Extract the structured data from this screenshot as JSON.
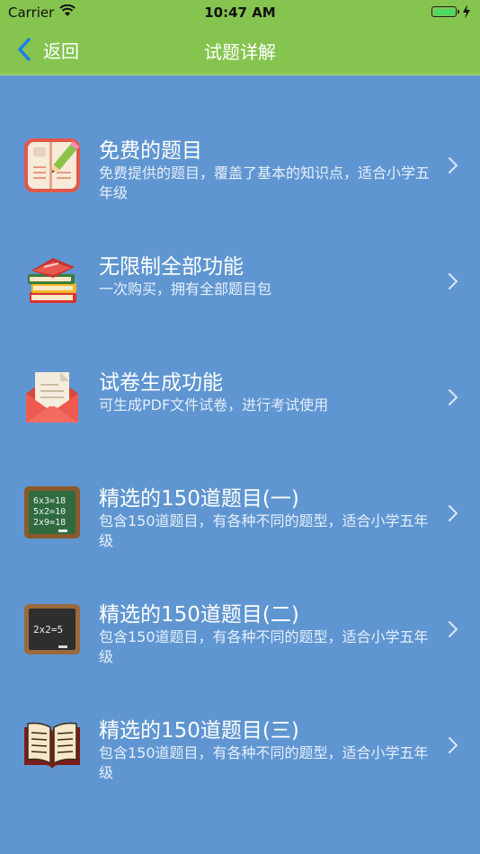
{
  "status_bar": {
    "carrier": "Carrier",
    "time": "10:47 AM"
  },
  "nav": {
    "back_label": "返回",
    "title": "试题详解"
  },
  "items": [
    {
      "title": "免费的题目",
      "desc": "免费提供的题目，覆盖了基本的知识点，适合小学五年级",
      "icon": "notebook-pencil-icon"
    },
    {
      "title": "无限制全部功能",
      "desc": "一次购买，拥有全部题目包",
      "icon": "book-stack-icon"
    },
    {
      "title": "试卷生成功能",
      "desc": "可生成PDF文件试卷，进行考试使用",
      "icon": "envelope-letter-icon"
    },
    {
      "title": "精选的150道题目(一)",
      "desc": "包含150道题目，有各种不同的题型，适合小学五年级",
      "icon": "green-chalkboard-icon",
      "board_lines": [
        "6x3=18",
        "5x2=10",
        "2x9=18"
      ]
    },
    {
      "title": "精选的150道题目(二)",
      "desc": "包含150道题目，有各种不同的题型，适合小学五年级",
      "icon": "black-chalkboard-icon",
      "board_lines": [
        "2x2=5"
      ]
    },
    {
      "title": "精选的150道题目(三)",
      "desc": "包含150道题目，有各种不同的题型，适合小学五年级",
      "icon": "open-book-icon"
    }
  ],
  "colors": {
    "nav_green": "#86c450",
    "background_blue": "#5f96d1",
    "back_arrow_blue": "#1a7cf5"
  }
}
